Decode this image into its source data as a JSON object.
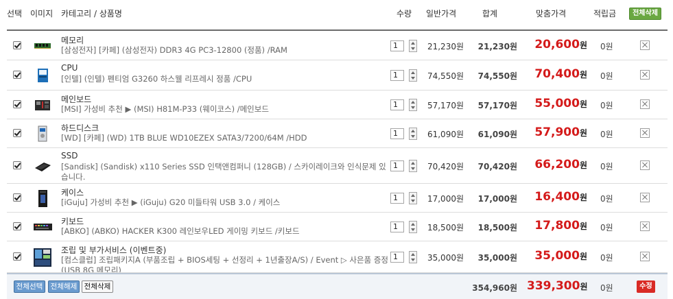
{
  "header": {
    "select": "선택",
    "image": "이미지",
    "category_product": "카테고리 / 상품명",
    "quantity": "수량",
    "regular_price": "일반가격",
    "subtotal": "합계",
    "custom_price": "맞춤가격",
    "points": "적립금",
    "delete_all": "전체삭제"
  },
  "items": [
    {
      "category": "메모리",
      "name": "[삼성전자] [카페] (삼성전자) DDR3 4G PC3-12800 (정품) /RAM",
      "qty": "1",
      "price": "21,230원",
      "total": "21,230원",
      "sale": "20,600",
      "sale_unit": "원",
      "points": "0원",
      "thumb_icon": "ram-icon"
    },
    {
      "category": "CPU",
      "name": "[인텔] (인텔) 펜티엄 G3260 하스웰 리프레시 정품 /CPU",
      "qty": "1",
      "price": "74,550원",
      "total": "74,550원",
      "sale": "70,400",
      "sale_unit": "원",
      "points": "0원",
      "thumb_icon": "cpu-icon"
    },
    {
      "category": "메인보드",
      "name": "[MSI] 가성비 추천 ▶ (MSI) H81M-P33 (웨이코스) /메인보드",
      "qty": "1",
      "price": "57,170원",
      "total": "57,170원",
      "sale": "55,000",
      "sale_unit": "원",
      "points": "0원",
      "thumb_icon": "motherboard-icon"
    },
    {
      "category": "하드디스크",
      "name": "[WD] [카페] (WD) 1TB BLUE WD10EZEX SATA3/7200/64M /HDD",
      "qty": "1",
      "price": "61,090원",
      "total": "61,090원",
      "sale": "57,900",
      "sale_unit": "원",
      "points": "0원",
      "thumb_icon": "hdd-icon"
    },
    {
      "category": "SSD",
      "name": "[Sandisk] (Sandisk) x110 Series SSD 인택앤컴퍼니 (128GB) / 스카이레이크와 인식문제 있습니다.",
      "qty": "1",
      "price": "70,420원",
      "total": "70,420원",
      "sale": "66,200",
      "sale_unit": "원",
      "points": "0원",
      "thumb_icon": "ssd-icon"
    },
    {
      "category": "케이스",
      "name": "[iGuju] 가성비 추천 ▶ (iGuju) G20 미들타워 USB 3.0 / 케이스",
      "qty": "1",
      "price": "17,000원",
      "total": "17,000원",
      "sale": "16,400",
      "sale_unit": "원",
      "points": "0원",
      "thumb_icon": "case-icon"
    },
    {
      "category": "키보드",
      "name": "[ABKO] (ABKO) HACKER K300 레인보우LED 게이밍 키보드 /키보드",
      "qty": "1",
      "price": "18,500원",
      "total": "18,500원",
      "sale": "17,800",
      "sale_unit": "원",
      "points": "0원",
      "thumb_icon": "keyboard-icon"
    },
    {
      "category": "조립 및 부가서비스 (이벤트중)",
      "name": "[컴스클럽] 조립패키지A (부품조립 + BIOS세팅 + 선정리 + 1년출장A/S) / Event ▷ 사은품 증정(USB 8G 메모리)",
      "qty": "1",
      "price": "35,000원",
      "total": "35,000원",
      "sale": "35,000",
      "sale_unit": "원",
      "points": "0원",
      "thumb_icon": "assembly-service-icon"
    }
  ],
  "footer": {
    "select_all": "전체선택",
    "deselect_all": "전체해제",
    "delete_all": "전체삭제",
    "grand_total": "354,960원",
    "grand_sale": "339,300",
    "grand_sale_unit": "원",
    "grand_points": "0원",
    "edit": "수정"
  },
  "colors": {
    "accent_red": "#d41a1a",
    "header_green": "#6aa842",
    "footer_blue": "#6a9bcf",
    "edit_red": "#d92a25"
  }
}
